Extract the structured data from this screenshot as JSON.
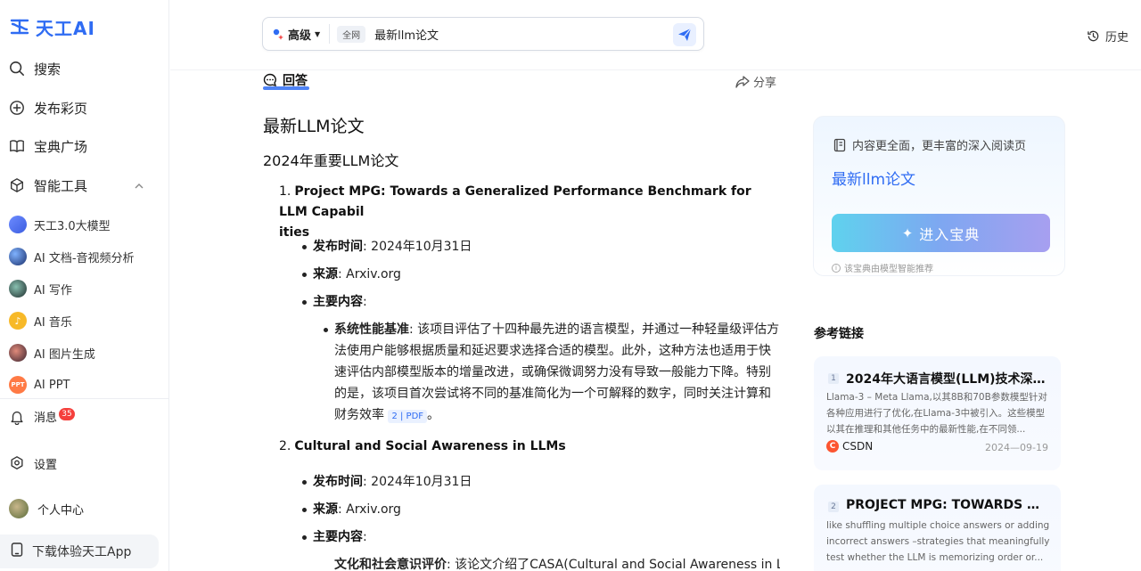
{
  "brand": {
    "name": "天工AI",
    "accent": "#2f6cf3"
  },
  "sidebar": {
    "nav": [
      {
        "label": "搜索",
        "icon": "search-icon"
      },
      {
        "label": "发布彩页",
        "icon": "plus-circle-icon"
      },
      {
        "label": "宝典广场",
        "icon": "book-icon"
      },
      {
        "label": "智能工具",
        "icon": "cube-icon"
      }
    ],
    "tools": [
      {
        "label": "天工3.0大模型",
        "icon": "model-avatar-icon"
      },
      {
        "label": "AI 文档-音视频分析",
        "icon": "doc-avatar-icon"
      },
      {
        "label": "AI 写作",
        "icon": "writing-avatar-icon"
      },
      {
        "label": "AI 音乐",
        "icon": "music-avatar-icon"
      },
      {
        "label": "AI 图片生成",
        "icon": "image-avatar-icon"
      },
      {
        "label": "AI PPT",
        "icon": "ppt-avatar-icon",
        "badge_text": "PPT"
      }
    ],
    "messages": {
      "label": "消息",
      "count": "35"
    },
    "settings": {
      "label": "设置"
    },
    "profile": {
      "label": "个人中心"
    },
    "download": {
      "label": "下载体验天工App"
    }
  },
  "search": {
    "mode": "高级",
    "scope": "全网",
    "query": "最新llm论文"
  },
  "history": {
    "label": "历史"
  },
  "answer": {
    "tab_label": "回答",
    "share_label": "分享",
    "title": "最新LLM论文",
    "subtitle": "2024年重要LLM论文",
    "items": [
      {
        "number": "1.",
        "title": "Project MPG: Towards a Generalized Performance Benchmark for LLM Capabilities",
        "title_line1": "Project MPG: Towards a Generalized Performance Benchmark for LLM Capabil",
        "title_line2": "ities",
        "date_label": "发布时间",
        "date": ": 2024年10月31日",
        "source_label": "来源",
        "source": ": Arxiv.org",
        "content_label": "主要内容",
        "content_colon": ":",
        "point_label": "系统性能基准",
        "point_text": ": 该项目评估了十四种最先进的语言模型，并通过一种轻量级评估方法使用户能够根据质量和延迟要求选择合适的模型。此外，这种方法也适用于快速评估内部模型版本的增量改进，或确保微调努力没有导致一般能力下降。特别的是，该项目首次尝试将不同的基准简化为一个可解释的数字，同时关注计算和财务效率",
        "citation": "2 | PDF",
        "end_mark": "。"
      },
      {
        "number": "2.",
        "title": "Cultural and Social Awareness in LLMs",
        "date_label": "发布时间",
        "date": ": 2024年10月31日",
        "source_label": "来源",
        "source": ": Arxiv.org",
        "content_label": "主要内容",
        "content_colon": ":",
        "point_label": "文化和社会意识评价",
        "point_text": ": 该论文介绍了CASA(Cultural and Social Awareness in LL"
      }
    ]
  },
  "deep_read_card": {
    "hint": "内容更全面，更丰富的深入阅读页",
    "title": "最新llm论文",
    "button": "进入宝典",
    "footnote": "该宝典由模型智能推荐"
  },
  "references": {
    "title": "参考链接",
    "items": [
      {
        "index": "1",
        "title": "2024年大语言模型(LLM)技术深度...",
        "snippet": "Llama-3 – Meta Llama,以其8B和70B参数模型针对各种应用进行了优化,在Llama-3中被引入。这些模型以其在推理和其他任务中的最新性能,在不同领...",
        "source": "CSDN",
        "date": "2024—09-19"
      },
      {
        "index": "2",
        "title": "PROJECT MPG: TOWARDS A G...",
        "snippet": "like shuffling multiple choice answers or adding incorrect answers –strategies that meaningfully test whether the LLM is memorizing order or..."
      }
    ]
  }
}
